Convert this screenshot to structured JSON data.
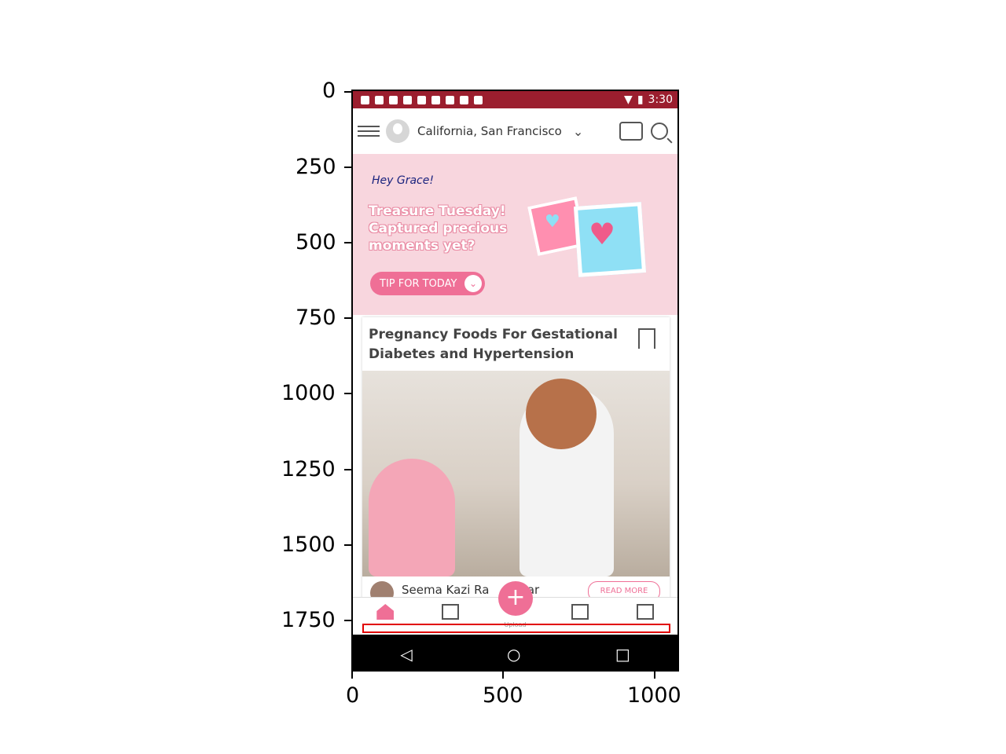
{
  "status_bar": {
    "time": "3:30"
  },
  "top_bar": {
    "location": "California, San Francisco"
  },
  "banner": {
    "greeting": "Hey Grace!",
    "headline": "Treasure Tuesday! Captured precious moments yet?",
    "tip_button": "TIP FOR TODAY"
  },
  "card": {
    "title": "Pregnancy Foods For Gestational Diabetes and Hypertension",
    "author": "Seema Kazi Ra",
    "author_suffix": "kar",
    "read_more": "READ MORE"
  },
  "bottom_nav": {
    "fab_label": "Upload"
  },
  "axes": {
    "y_ticks": [
      "0",
      "250",
      "500",
      "750",
      "1000",
      "1250",
      "1500",
      "1750"
    ],
    "x_ticks": [
      "0",
      "500",
      "1000"
    ]
  },
  "colors": {
    "status_bar": "#9b1e2e",
    "accent": "#ef6f96",
    "banner_bg": "#f8d6de",
    "highlight_box": "#e10000"
  }
}
